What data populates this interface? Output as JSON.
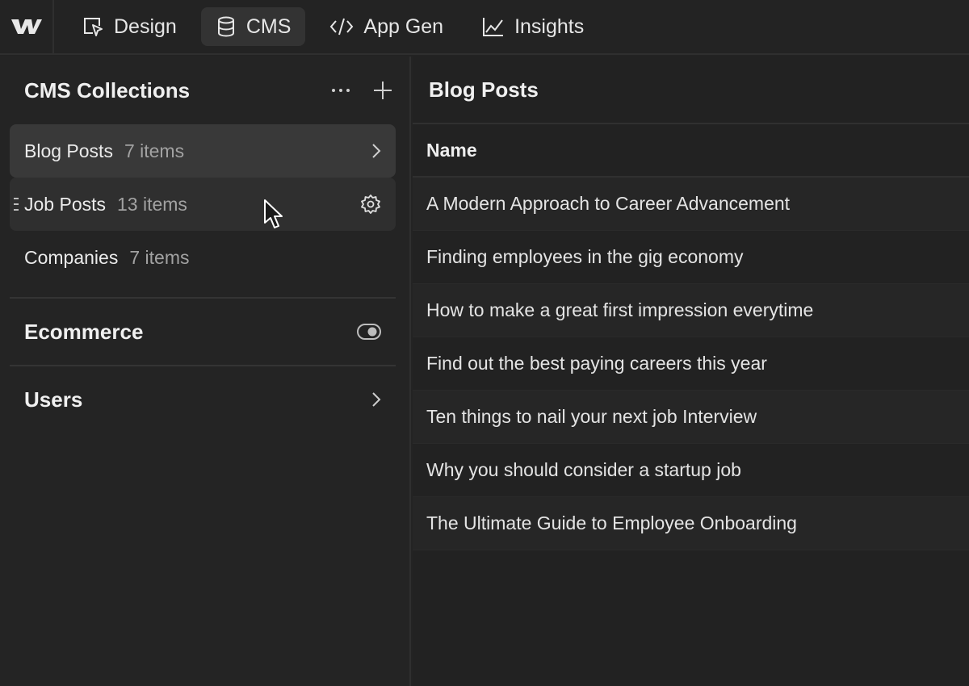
{
  "topbar": {
    "logo_icon": "webflow-logo",
    "tabs": [
      {
        "label": "Design",
        "icon": "design-cursor-icon",
        "active": false
      },
      {
        "label": "CMS",
        "icon": "database-icon",
        "active": true
      },
      {
        "label": "App Gen",
        "icon": "code-icon",
        "active": false
      },
      {
        "label": "Insights",
        "icon": "chart-line-icon",
        "active": false
      }
    ]
  },
  "sidebar": {
    "title": "CMS Collections",
    "collections": [
      {
        "name": "Blog Posts",
        "count": "7 items"
      },
      {
        "name": "Job Posts",
        "count": "13 items"
      },
      {
        "name": "Companies",
        "count": "7 items"
      }
    ],
    "ecommerce": {
      "label": "Ecommerce",
      "toggle": "off"
    },
    "users": {
      "label": "Users"
    }
  },
  "main": {
    "title": "Blog Posts",
    "column_header": "Name",
    "rows": [
      "A Modern Approach to Career Advancement",
      "Finding employees in the gig economy",
      "How to make a great first impression everytime",
      "Find out the best paying careers this year",
      "Ten things to nail your next job Interview",
      "Why you should consider a startup job",
      "The Ultimate Guide to Employee Onboarding"
    ]
  },
  "colors": {
    "background": "#232323",
    "selected": "#393939",
    "text": "#e8e8e8",
    "muted": "#a2a2a2"
  }
}
